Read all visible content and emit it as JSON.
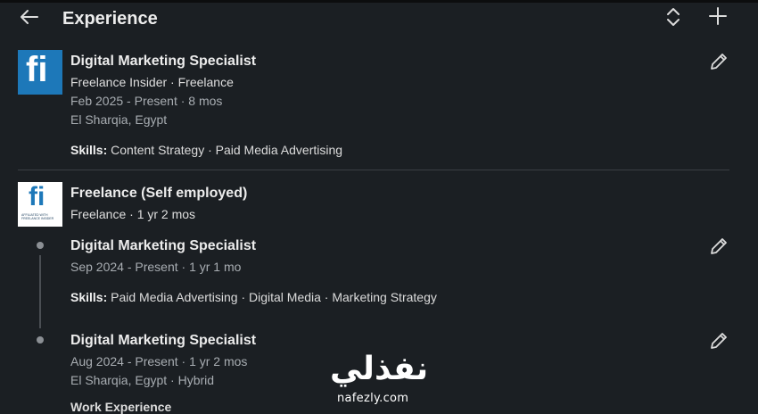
{
  "header": {
    "title": "Experience"
  },
  "positions": [
    {
      "company_logo_text": "fi",
      "title": "Digital Marketing Specialist",
      "company_line": "Freelance Insider · Freelance",
      "dates": "Feb 2025 - Present · 8 mos",
      "location": "El Sharqia, Egypt",
      "skills_label": "Skills:",
      "skills": "Content Strategy · Paid Media Advertising"
    }
  ],
  "group": {
    "company_logo_text": "fi",
    "company_logo_caption": "AFFILIATED WITH FREELANCE INSIDER",
    "company": "Freelance (Self employed)",
    "summary": "Freelance · 1 yr 2 mos",
    "roles": [
      {
        "title": "Digital Marketing Specialist",
        "dates": "Sep 2024 - Present · 1 yr 1 mo",
        "skills_label": "Skills:",
        "skills": "Paid Media Advertising · Digital Media · Marketing Strategy"
      },
      {
        "title": "Digital Marketing Specialist",
        "dates": "Aug 2024 - Present · 1 yr 2 mos",
        "location": "El Sharqia, Egypt · Hybrid",
        "cut_off": "Work Experience"
      }
    ]
  },
  "watermark": {
    "arabic": "نفذلي",
    "latin": "nafezly.com"
  },
  "icons": {
    "back": "back-arrow-icon",
    "reorder": "reorder-icon",
    "add": "plus-icon",
    "edit": "pencil-icon"
  }
}
